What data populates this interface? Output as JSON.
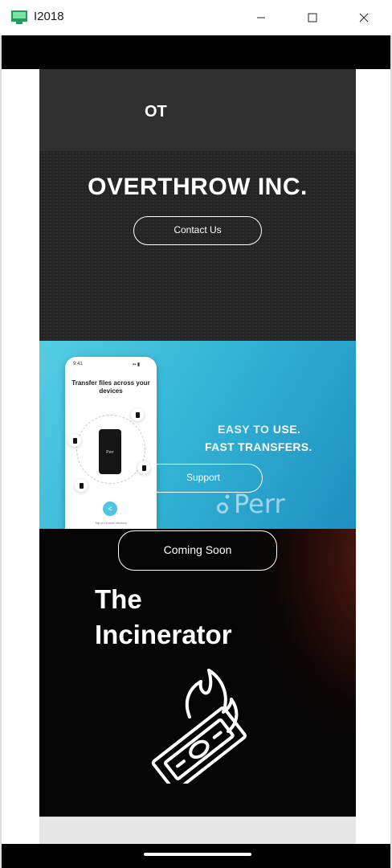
{
  "window": {
    "title": "I2018"
  },
  "site": {
    "logo": "OT",
    "hero": {
      "title": "OVERTHROW INC.",
      "contact_label": "Contact Us"
    },
    "pierr": {
      "headline_line1_a": "EASY TO ",
      "headline_line1_b": "USE.",
      "headline_line2": "FAST TRANSFERS.",
      "support_label": "Support",
      "logo_text": "Perr",
      "phone_heading": "Transfer files across your devices",
      "phone_device_logo": "Perr",
      "phone_time": "9:41",
      "phone_footer": "Tap to receive devices",
      "accent_color": "#33b5d6"
    },
    "incinerator": {
      "coming_label": "Coming Soon",
      "title_line1": "The",
      "title_line2": "Incinerator"
    }
  },
  "icons": {
    "app": "app-window-icon",
    "minimize": "minimize-icon",
    "maximize": "maximize-icon",
    "close": "close-icon",
    "burning_money": "burning-money-icon",
    "share": "share-icon"
  }
}
